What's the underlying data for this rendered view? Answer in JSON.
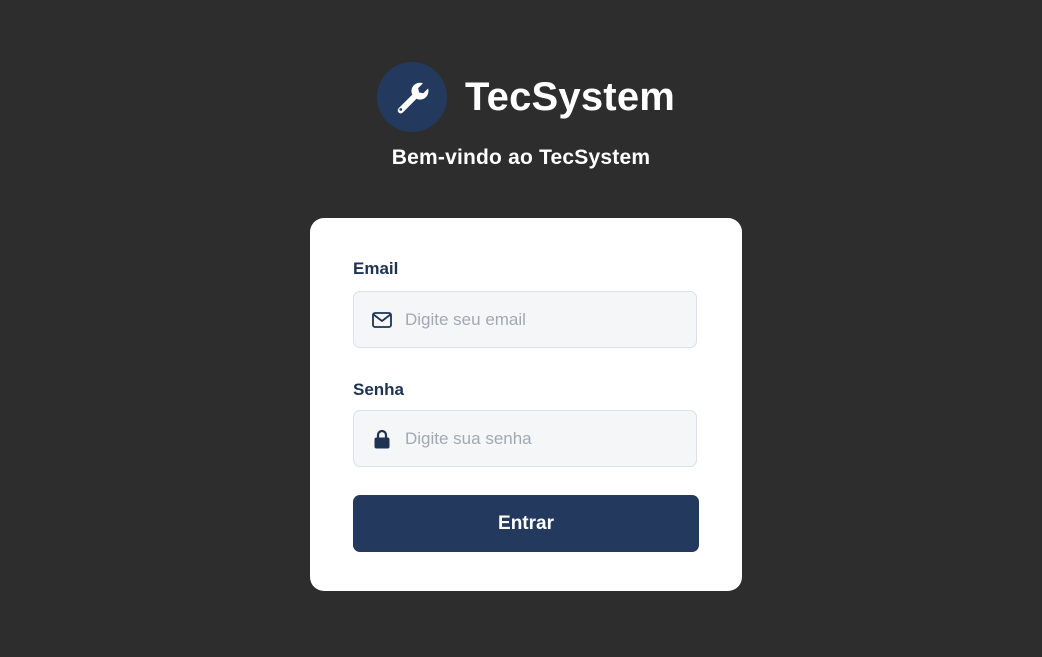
{
  "brand": {
    "title": "TecSystem",
    "logo_icon": "wrench-icon"
  },
  "welcome_text": "Bem-vindo ao TecSystem",
  "form": {
    "email": {
      "label": "Email",
      "placeholder": "Digite seu email",
      "value": "",
      "icon": "envelope-icon"
    },
    "password": {
      "label": "Senha",
      "placeholder": "Digite sua senha",
      "value": "",
      "icon": "lock-icon"
    },
    "submit_label": "Entrar"
  },
  "colors": {
    "background": "#2d2d2d",
    "primary": "#233a5e",
    "card": "#ffffff",
    "input_bg": "#f5f6f8",
    "placeholder": "#a2a9b4"
  }
}
